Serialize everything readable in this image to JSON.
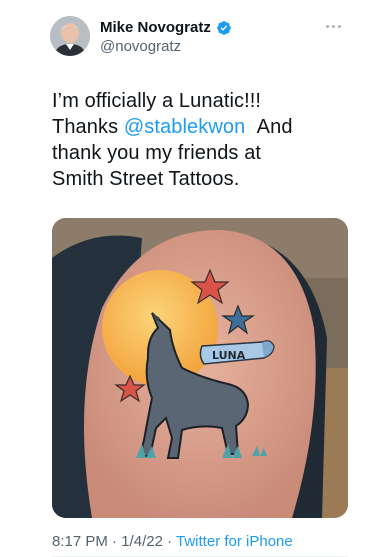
{
  "tweet": {
    "author": {
      "display_name": "Mike Novogratz",
      "handle": "@novogratz",
      "verified_icon": "verified-badge-icon",
      "avatar_icon": "avatar"
    },
    "text": {
      "line1": "I’m officially a Lunatic!!!",
      "thanks": "Thanks",
      "mention": "@stablekwon",
      "and": "And",
      "line3": "thank you my friends at",
      "line4": "Smith Street Tattoos."
    },
    "media": {
      "banner_text": "LUNA"
    },
    "meta": {
      "time": "8:17 PM",
      "date": "1/4/22",
      "separator": "·",
      "source": "Twitter for iPhone"
    },
    "more_icon": "more-options-icon",
    "colors": {
      "accent": "#1d9bf0",
      "secondary_text": "#536471",
      "primary_text": "#0f1419"
    }
  }
}
